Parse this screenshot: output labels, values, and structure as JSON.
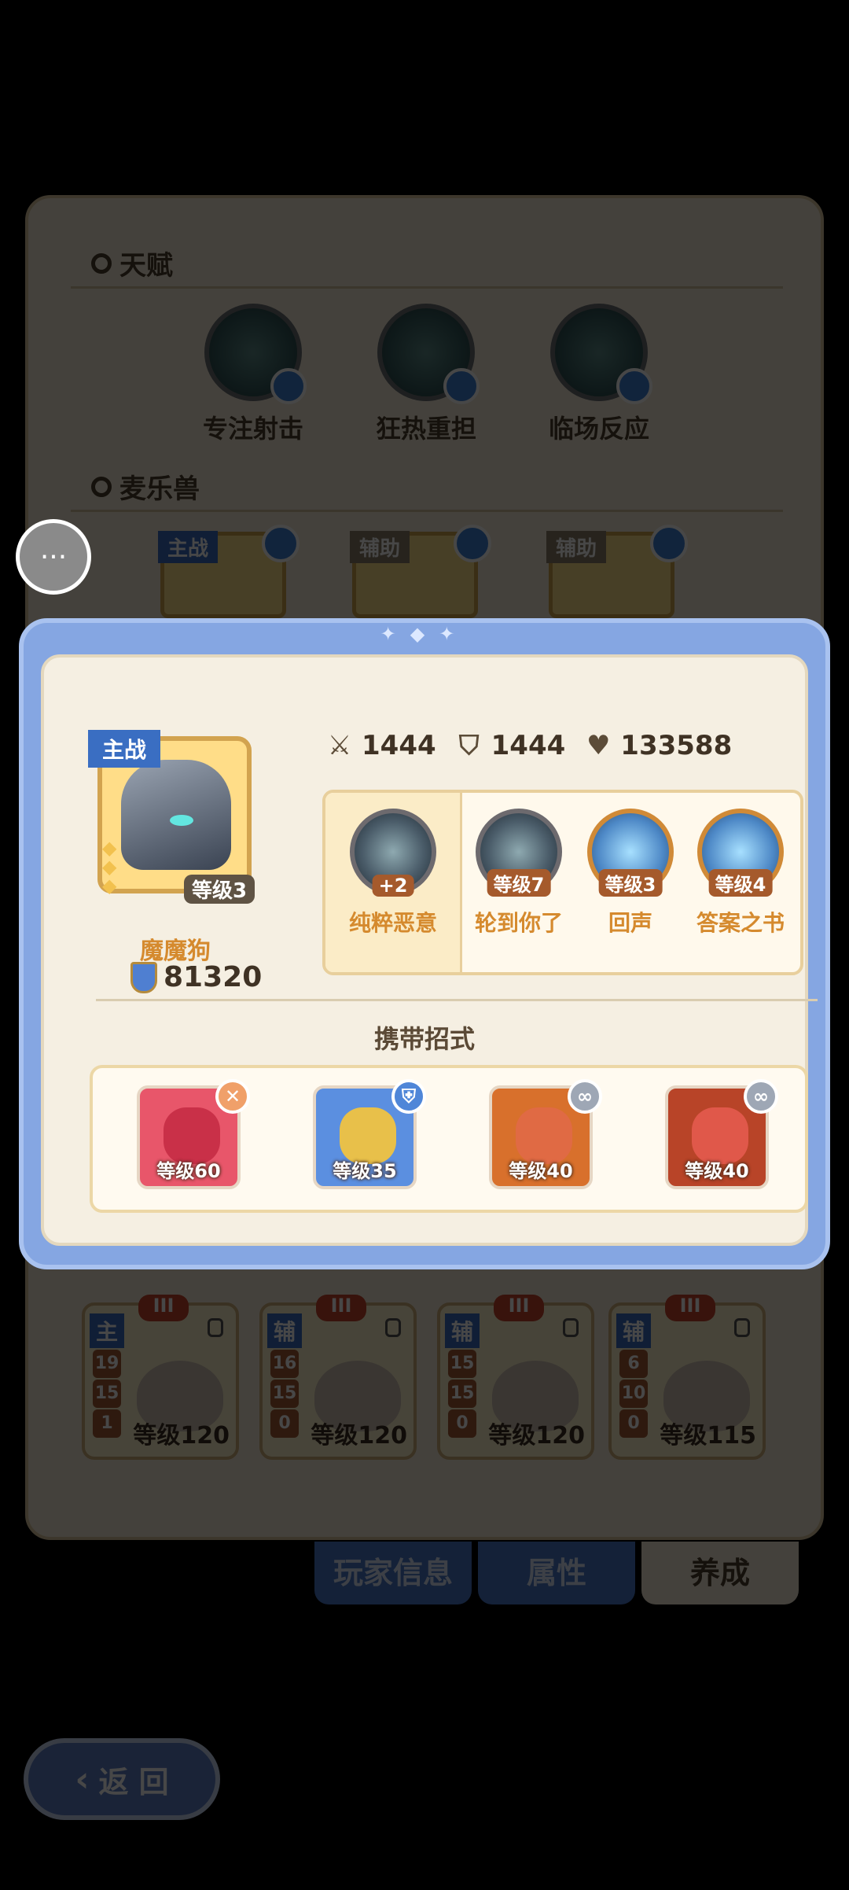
{
  "background": {
    "talent_title": "天赋",
    "talents": [
      {
        "name": "专注射击",
        "icon": "bow-emblem-icon"
      },
      {
        "name": "狂热重担",
        "icon": "eye-emblem-icon"
      },
      {
        "name": "临场反应",
        "icon": "pyramid-emblem-icon"
      }
    ],
    "pet_title": "麦乐兽",
    "pets": [
      {
        "tag": "主战"
      },
      {
        "tag": "辅助"
      },
      {
        "tag": "辅助"
      }
    ],
    "rune_cards": [
      {
        "tag": "主",
        "roman": "III",
        "stats": [
          "19",
          "15",
          "1"
        ],
        "level": "等级120"
      },
      {
        "tag": "辅",
        "roman": "III",
        "stats": [
          "16",
          "15",
          "0"
        ],
        "level": "等级120"
      },
      {
        "tag": "辅",
        "roman": "III",
        "stats": [
          "15",
          "15",
          "0"
        ],
        "level": "等级120"
      },
      {
        "tag": "辅",
        "roman": "III",
        "stats": [
          "6",
          "10",
          "0"
        ],
        "level": "等级115"
      }
    ],
    "tabs": [
      {
        "label": "玩家信息",
        "active": false
      },
      {
        "label": "属性",
        "active": false
      },
      {
        "label": "养成",
        "active": true
      }
    ],
    "back_label": "返  回"
  },
  "modal": {
    "hero": {
      "tag": "主战",
      "name": "魔魔狗",
      "level": "等级3",
      "power": "81320",
      "stars": 3
    },
    "stats": {
      "attack": "1444",
      "defense": "1444",
      "hp": "133588"
    },
    "skills": [
      {
        "name": "纯粹恶意",
        "level": "+2",
        "style": "dark"
      },
      {
        "name": "轮到你了",
        "level": "等级7",
        "style": "dark"
      },
      {
        "name": "回声",
        "level": "等级3",
        "style": "light"
      },
      {
        "name": "答案之书",
        "level": "等级4",
        "style": "light"
      }
    ],
    "carry_title": "携带招式",
    "moves": [
      {
        "level": "等级60",
        "badge": "✕",
        "badge_color": "#f0a06a",
        "bg": "#e8566a",
        "fig": "#c93048"
      },
      {
        "level": "等级35",
        "badge": "⛨",
        "badge_color": "#4f86d8",
        "bg": "#5b8fe0",
        "fig": "#e8c04a"
      },
      {
        "level": "等级40",
        "badge": "∞",
        "badge_color": "#9ea7b5",
        "bg": "#d8702c",
        "fig": "#e06a44"
      },
      {
        "level": "等级40",
        "badge": "∞",
        "badge_color": "#9ea7b5",
        "bg": "#b84428",
        "fig": "#e0584a"
      }
    ]
  },
  "colors": {
    "modal_border": "#85a6e2",
    "panel_bg": "#f5efe2",
    "accent_orange": "#d58a2e",
    "tag_blue": "#3a6ec2"
  }
}
